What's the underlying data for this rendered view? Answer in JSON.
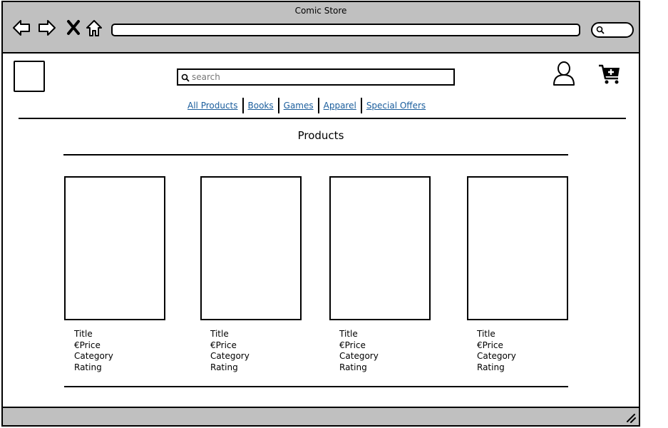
{
  "window": {
    "title": "Comic Store"
  },
  "browser": {
    "nav_icons": [
      "back-arrow-icon",
      "forward-arrow-icon",
      "close-x-icon",
      "home-icon"
    ],
    "address_value": "",
    "search_icon": "search-icon"
  },
  "header": {
    "search": {
      "placeholder": "search",
      "value": ""
    },
    "account_icon": "user-icon",
    "cart_icon": "cart-add-icon"
  },
  "nav": {
    "tabs": [
      {
        "label": "All Products"
      },
      {
        "label": "Books"
      },
      {
        "label": "Games"
      },
      {
        "label": "Apparel"
      },
      {
        "label": "Special Offers"
      }
    ]
  },
  "main": {
    "title": "Products",
    "products": [
      {
        "title": "Title",
        "price": "€Price",
        "category": "Category",
        "rating": "Rating"
      },
      {
        "title": "Title",
        "price": "€Price",
        "category": "Category",
        "rating": "Rating"
      },
      {
        "title": "Title",
        "price": "€Price",
        "category": "Category",
        "rating": "Rating"
      },
      {
        "title": "Title",
        "price": "€Price",
        "category": "Category",
        "rating": "Rating"
      }
    ]
  },
  "colors": {
    "chrome": "#c0c0c0",
    "link": "#1a5d9c",
    "stroke": "#000000"
  }
}
